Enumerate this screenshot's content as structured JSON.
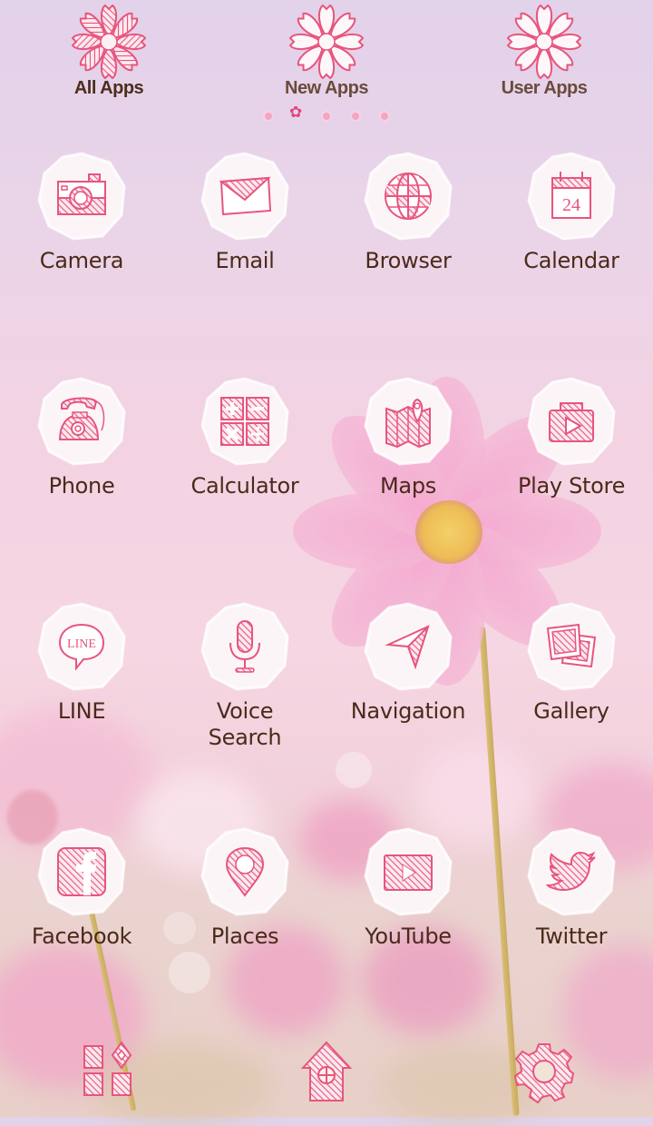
{
  "colors": {
    "accent_pink": "#e8557d",
    "label_brown": "#4a2a1a",
    "icon_bg": "#fbf5f8"
  },
  "top_tabs": [
    {
      "label": "All Apps",
      "icon": "sakura-filled-icon",
      "active": true
    },
    {
      "label": "New Apps",
      "icon": "sakura-outline-icon",
      "active": false
    },
    {
      "label": "User Apps",
      "icon": "sakura-outline-icon",
      "active": false
    }
  ],
  "pager": {
    "count": 5,
    "current": 2
  },
  "apps": [
    {
      "label": "Camera",
      "icon": "camera-icon"
    },
    {
      "label": "Email",
      "icon": "envelope-icon"
    },
    {
      "label": "Browser",
      "icon": "globe-icon"
    },
    {
      "label": "Calendar",
      "icon": "calendar-icon",
      "icon_text": "24"
    },
    {
      "label": "Phone",
      "icon": "telephone-icon"
    },
    {
      "label": "Calculator",
      "icon": "calculator-icon"
    },
    {
      "label": "Maps",
      "icon": "map-icon"
    },
    {
      "label": "Play Store",
      "icon": "play-store-icon"
    },
    {
      "label": "LINE",
      "icon": "line-chat-icon",
      "icon_text": "LINE"
    },
    {
      "label": "Voice\nSearch",
      "label_lines": [
        "Voice",
        "Search"
      ],
      "icon": "microphone-icon"
    },
    {
      "label": "Navigation",
      "icon": "navigation-arrow-icon"
    },
    {
      "label": "Gallery",
      "icon": "photos-icon"
    },
    {
      "label": "Facebook",
      "icon": "facebook-icon"
    },
    {
      "label": "Places",
      "icon": "map-pin-icon"
    },
    {
      "label": "YouTube",
      "icon": "youtube-icon"
    },
    {
      "label": "Twitter",
      "icon": "twitter-bird-icon"
    }
  ],
  "dock": [
    {
      "name": "apps-grid-button",
      "icon": "apps-grid-icon"
    },
    {
      "name": "home-button",
      "icon": "home-icon"
    },
    {
      "name": "settings-button",
      "icon": "gear-icon"
    }
  ]
}
